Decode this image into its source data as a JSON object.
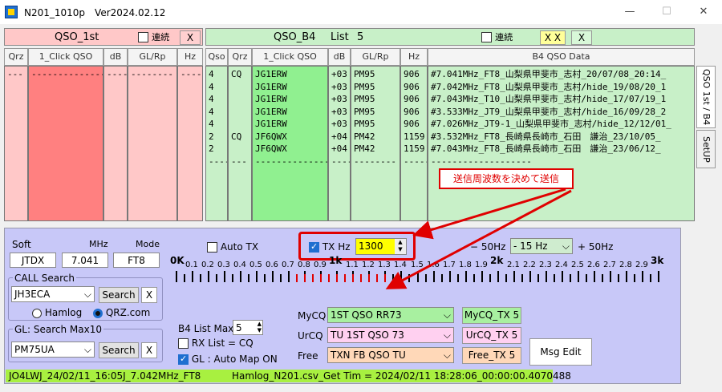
{
  "window": {
    "title": "N201_1010p　Ver2024.02.12",
    "min": "—",
    "max": "☐",
    "close": "✕"
  },
  "qso1st": {
    "title": "QSO_1st",
    "renzoku": "連続",
    "x": "X",
    "headers": [
      "Qrz",
      "1_Click QSO",
      "dB",
      "GL/Rp",
      "Hz"
    ],
    "col_qrz": "---",
    "col_click": "-------------------",
    "col_db": "-----",
    "col_gl": "--------",
    "col_hz": "-----"
  },
  "qsob4": {
    "title": "QSO_B4",
    "list": "List",
    "count": "5",
    "renzoku": "連続",
    "xx": "X X",
    "x": "X",
    "headers": [
      "Qso",
      "Qrz",
      "1_Click QSO",
      "dB",
      "GL/Rp",
      "Hz",
      "B4 QSO Data"
    ],
    "col_qso": "4\n4\n4\n4\n4\n2\n2\n-----",
    "col_qrz": "CQ\n\n\n\n\nCQ\n\n---",
    "col_click": "JG1ERW\nJG1ERW\nJG1ERW\nJG1ERW\nJG1ERW\nJF6QWX\nJF6QWX\n-------------------",
    "col_db": "+03\n+03\n+03\n+03\n+03\n+04\n+04\n-----",
    "col_gl": "PM95\nPM95\nPM95\nPM95\nPM95\nPM42\nPM42\n--------",
    "col_hz": "906\n906\n906\n906\n906\n1159\n1159\n-----",
    "col_data": "#7.041MHz_FT8_山梨県甲斐市_志村_20/07/08_20:14_\n#7.042MHz_FT8_山梨県甲斐市_志村/hide_19/08/20_1\n#7.043MHz_T10_山梨県甲斐市_志村/hide_17/07/19_1\n#3.533MHz_JT9_山梨県甲斐市_志村/hide_16/09/28_2\n#7.026MHz_JT9-1_山梨県甲斐市_志村/hide_12/12/01_\n#3.532MHz_FT8_長崎県長崎市_石田　謙治_23/10/05_\n#7.043MHz_FT8_長崎県長崎市_石田　謙治_23/06/12_\n-------------------"
  },
  "sidetabs": [
    "QSO 1st / B4",
    "SetUP"
  ],
  "annotation": "送信周波数を決めて送信",
  "soft": {
    "label": "Soft",
    "mhz_label": "MHz",
    "mode_label": "Mode",
    "soft": "JTDX",
    "mhz": "7.041",
    "mode": "FT8"
  },
  "call": {
    "label": "CALL Search",
    "value": "JH3ECA",
    "search": "Search",
    "x": "X",
    "hamlog": "Hamlog",
    "qrz": "QRZ.com"
  },
  "gl": {
    "label": "GL:  Search Max10",
    "value": "PM75UA",
    "search": "Search",
    "x": "X"
  },
  "autotx": "Auto TX",
  "txhz": {
    "label": "TX Hz",
    "value": "1300"
  },
  "offset": {
    "minus": "− 50Hz",
    "value": "- 15 Hz",
    "plus": "+ 50Hz"
  },
  "scale": {
    "left": "0K",
    "mid": "1k",
    "two": "2k",
    "right": "3k",
    "labels": [
      "0.1",
      "0.2",
      "0.3",
      "0.4",
      "0.5",
      "0.6",
      "0.7",
      "0.8",
      "0.9",
      "1.1",
      "1.2",
      "1.3",
      "1.4",
      "1.5",
      "1.6",
      "1.7",
      "1.8",
      "1.9",
      "2.1",
      "2.2",
      "2.3",
      "2.4",
      "2.5",
      "2.6",
      "2.7",
      "2.8",
      "2.9"
    ]
  },
  "b4max": {
    "label": "B4 List Max",
    "value": "5"
  },
  "rxlist": "RX List = CQ",
  "glmap": "GL : Auto Map ON",
  "mycq": {
    "label": "MyCQ",
    "value": "1ST QSO RR73",
    "btn": "MyCQ_TX 5"
  },
  "urcq": {
    "label": "UrCQ",
    "value": "TU 1ST QSO 73",
    "btn": "UrCQ_TX 5"
  },
  "free": {
    "label": "Free",
    "value": "TXN FB QSO TU",
    "btn": "Free_TX 5"
  },
  "msgedit": "Msg Edit",
  "status": {
    "left": "JO4LWJ_24/02/11_16:05J_7.042MHz_FT8",
    "right": "Hamlog_N201.csv_Get Tim = 2024/02/11 18:28:06_00:00:00.4070488"
  }
}
